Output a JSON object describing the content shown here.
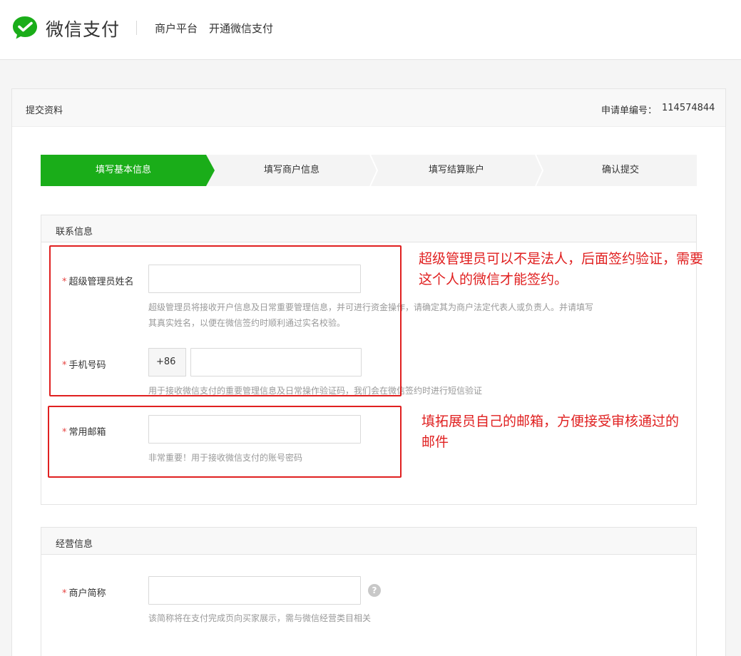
{
  "header": {
    "logo_text": "微信支付",
    "nav": [
      "商户平台",
      "开通微信支付"
    ],
    "brand_color": "#1aad19"
  },
  "panel": {
    "title": "提交资料",
    "application_no_label": "申请单编号：",
    "application_no": "114574844"
  },
  "steps": [
    {
      "label": "填写基本信息",
      "active": true
    },
    {
      "label": "填写商户信息",
      "active": false
    },
    {
      "label": "填写结算账户",
      "active": false
    },
    {
      "label": "确认提交",
      "active": false
    }
  ],
  "contact_section": {
    "title": "联系信息",
    "admin_name": {
      "required_mark": "*",
      "label": "超级管理员姓名",
      "value": "",
      "hint_line1": "超级管理员将接收开户信息及日常重要管理信息，并可进行资金操作，请确定其为商户法定代表人或负责人。并请填写",
      "hint_line2": "其真实姓名，以便在微信签约时顺利通过实名校验。"
    },
    "phone": {
      "required_mark": "*",
      "label": "手机号码",
      "prefix": "+86",
      "value": "",
      "hint": "用于接收微信支付的重要管理信息及日常操作验证码，我们会在微信签约时进行短信验证"
    },
    "email": {
      "required_mark": "*",
      "label": "常用邮箱",
      "value": "",
      "hint": "非常重要！用于接收微信支付的账号密码"
    }
  },
  "business_section": {
    "title": "经营信息",
    "short_name": {
      "required_mark": "*",
      "label": "商户简称",
      "value": "",
      "help_icon": "?",
      "hint": "该简称将在支付完成页向买家展示，需与微信经营类目相关"
    }
  },
  "annotations": {
    "admin_note_line1": "超级管理员可以不是法人，后面签约验证，需要",
    "admin_note_line2": "这个人的微信才能签约。",
    "email_note_line1": "填拓展员自己的邮箱，方便接受审核通过的",
    "email_note_line2": "邮件",
    "color": "#e02020"
  },
  "colors": {
    "active_step": "#1aad19",
    "required": "#e64340"
  }
}
